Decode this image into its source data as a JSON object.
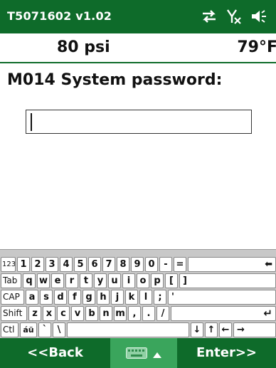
{
  "statusbar": {
    "title": "T5071602 v1.02",
    "icons": [
      "sync-arrows-icon",
      "no-signal-icon",
      "speaker-icon"
    ]
  },
  "info": {
    "pressure": "80 psi",
    "temperature": "79°F"
  },
  "prompt": "M014 System password:",
  "password_field": {
    "value": ""
  },
  "keyboard": {
    "rows": [
      [
        "123",
        "1",
        "2",
        "3",
        "4",
        "5",
        "6",
        "7",
        "8",
        "9",
        "0",
        "-",
        "=",
        "⬅"
      ],
      [
        "Tab",
        "q",
        "w",
        "e",
        "r",
        "t",
        "y",
        "u",
        "i",
        "o",
        "p",
        "[",
        "]"
      ],
      [
        "CAP",
        "a",
        "s",
        "d",
        "f",
        "g",
        "h",
        "j",
        "k",
        "l",
        ";",
        "'"
      ],
      [
        "Shift",
        "z",
        "x",
        "c",
        "v",
        "b",
        "n",
        "m",
        ",",
        ".",
        "/",
        "↵"
      ],
      [
        "Ctl",
        "áü",
        "`",
        "\\",
        "",
        "↓",
        "↑",
        "←",
        "→"
      ]
    ]
  },
  "bottombar": {
    "back_label": "<<Back",
    "enter_label": "Enter>>",
    "keyboard_icon": "keyboard-icon"
  },
  "colors": {
    "bar_green": "#0e6b2a",
    "toggle_green": "#3aa55c",
    "keyboard_bg": "#c8c8c8"
  }
}
